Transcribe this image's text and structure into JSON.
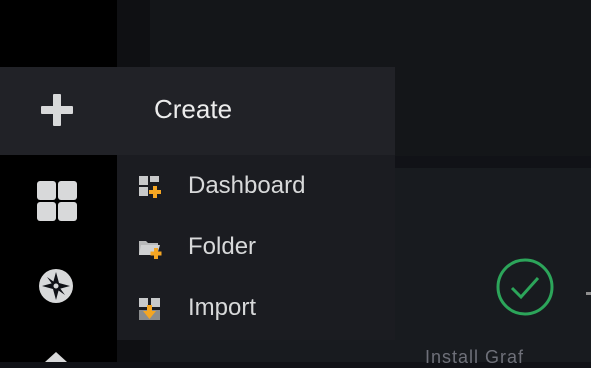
{
  "sidebar": {
    "icons": [
      "plus-icon",
      "dashboards-grid-icon",
      "explore-compass-icon",
      "caret-up-icon"
    ]
  },
  "create_menu": {
    "header": "Create",
    "items": [
      {
        "label": "Dashboard",
        "icon": "dashboard-add-icon"
      },
      {
        "label": "Folder",
        "icon": "folder-add-icon"
      },
      {
        "label": "Import",
        "icon": "import-icon"
      }
    ]
  },
  "content": {
    "status_icon": "check-circle-icon",
    "status_color": "#2ca55a",
    "partial_text": "Install Graf"
  },
  "colors": {
    "accent": "#f5a623",
    "sidebar_bg": "#000000",
    "menu_bg": "#1b1c21",
    "header_bg": "#212227"
  }
}
